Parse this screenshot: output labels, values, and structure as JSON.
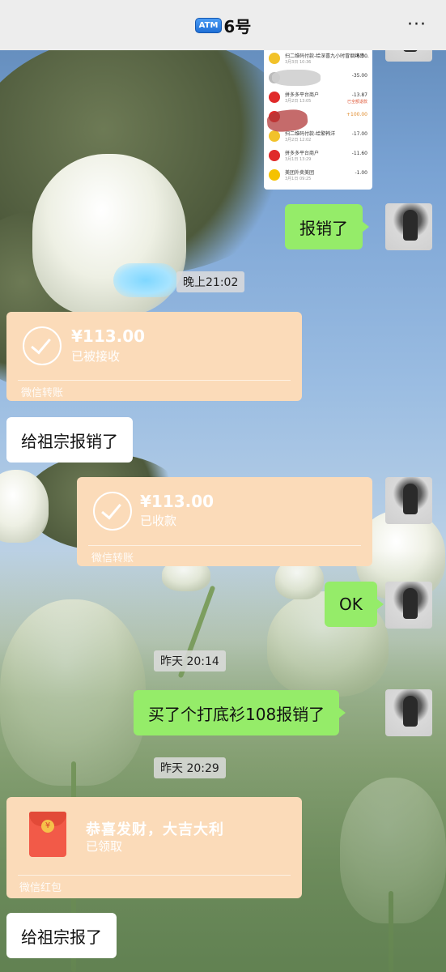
{
  "header": {
    "badge": "ATM",
    "title": "6号",
    "more": "···"
  },
  "receipt": {
    "rows": [
      {
        "text": "扫二维码付款-给深喜九小时冒烟烤串...",
        "date": "3月3日 10:36",
        "amount": "-6.00",
        "icon_color": "#f2c22a"
      },
      {
        "text": "",
        "date": "",
        "amount": "-35.00",
        "icon_color": "#bbbbbb"
      },
      {
        "text": "拼多多平台商户",
        "date": "3月2日 13:05",
        "amount": "-13.87",
        "tag": "已全额退款",
        "icon_color": "#e02a2a"
      },
      {
        "text": "",
        "date": "",
        "amount": "+100.00",
        "icon_color": "#e02a2a"
      },
      {
        "text": "扫二维码付款-给繁韩洋",
        "date": "3月2日 12:02",
        "amount": "-17.00",
        "icon_color": "#f2c22a"
      },
      {
        "text": "拼多多平台商户",
        "date": "3月1日 13:29",
        "amount": "-11.60",
        "icon_color": "#e02a2a"
      },
      {
        "text": "美团外卖美团",
        "date": "3月1日 09:25",
        "amount": "-1.00",
        "icon_color": "#f5c200"
      }
    ]
  },
  "messages": {
    "m1": "报销了",
    "ts1": "晚上21:02",
    "t1": {
      "amount": "¥113.00",
      "status": "已被接收",
      "footer": "微信转账"
    },
    "m2": "给祖宗报销了",
    "t2": {
      "amount": "¥113.00",
      "status": "已收款",
      "footer": "微信转账"
    },
    "m3": "OK",
    "ts2": "昨天 20:14",
    "m4": "买了个打底衫108报销了",
    "ts3": "昨天 20:29",
    "rp": {
      "title": "恭喜发财，大吉大利",
      "status": "已领取",
      "footer": "微信红包"
    },
    "m5": "给祖宗报了"
  },
  "colors": {
    "green_bubble": "#95ec69",
    "transfer_card": "#fbdbb9",
    "topbar": "#ededed"
  }
}
